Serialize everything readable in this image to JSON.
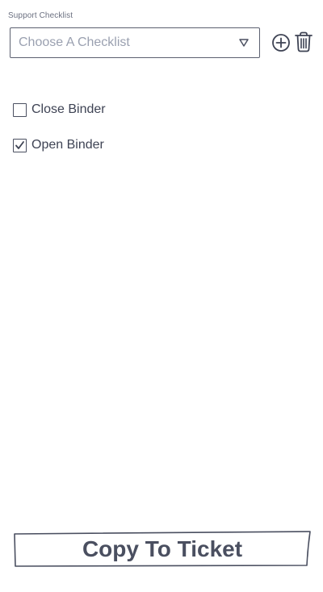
{
  "checklist_select": {
    "label": "Support Checklist",
    "placeholder": "Choose A Checklist"
  },
  "icons": {
    "add": "plus-circle-icon",
    "delete": "trash-icon",
    "caret": "caret-down-icon"
  },
  "items": [
    {
      "label": "Close Binder",
      "checked": false
    },
    {
      "label": "Open Binder",
      "checked": true
    }
  ],
  "actions": {
    "copy_label": "Copy To Ticket"
  }
}
